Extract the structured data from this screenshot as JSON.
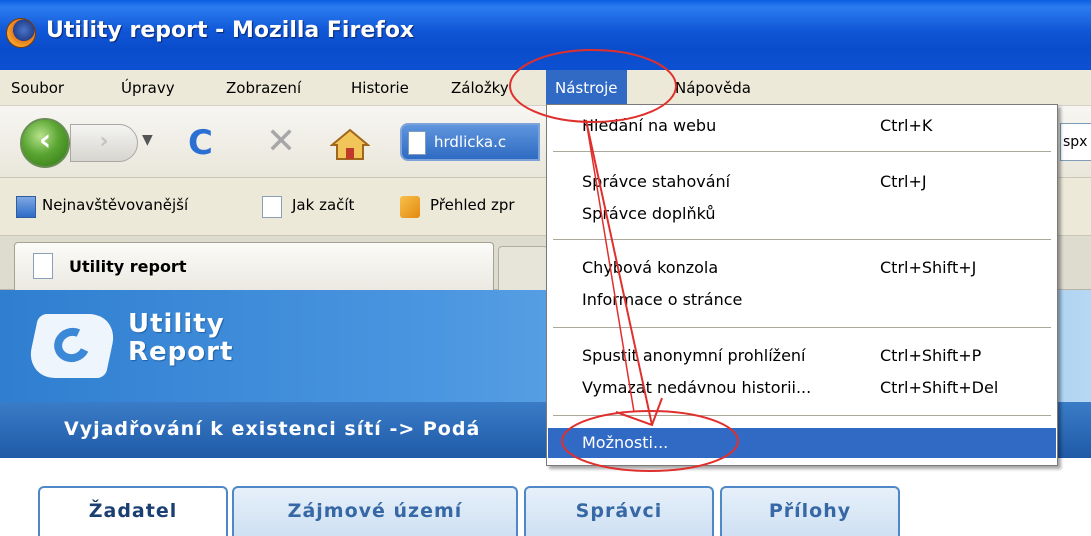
{
  "window": {
    "title": "Utility report - Mozilla Firefox"
  },
  "menubar": {
    "items": [
      "Soubor",
      "Úpravy",
      "Zobrazení",
      "Historie",
      "Záložky",
      "Nástroje",
      "Nápověda"
    ],
    "active": "Nástroje"
  },
  "navbar": {
    "url_text": "hrdlicka.c",
    "url_right_text": "spx",
    "icons": [
      "back-icon",
      "forward-icon",
      "dropdown-icon",
      "reload-icon",
      "stop-icon",
      "home-icon"
    ]
  },
  "bookmarks": {
    "items": [
      "Nejnavštěvovanější",
      "Jak začít",
      "Přehled zpr"
    ]
  },
  "tabs": {
    "active_label": "Utility report"
  },
  "page": {
    "logo_line1": "Utility",
    "logo_line2": "Report",
    "path": "Vyjadřování k existenci sítí -> Podá",
    "tabs": [
      "Žadatel",
      "Zájmové území",
      "Správci",
      "Přílohy"
    ],
    "active_tab": "Žadatel"
  },
  "dropdown": {
    "groups": [
      [
        {
          "label": "Hledání na webu",
          "shortcut": "Ctrl+K"
        }
      ],
      [
        {
          "label": "Správce stahování",
          "shortcut": "Ctrl+J"
        },
        {
          "label": "Správce doplňků",
          "shortcut": ""
        }
      ],
      [
        {
          "label": "Chybová konzola",
          "shortcut": "Ctrl+Shift+J"
        },
        {
          "label": "Informace o stránce",
          "shortcut": ""
        }
      ],
      [
        {
          "label": "Spustit anonymní prohlížení",
          "shortcut": "Ctrl+Shift+P"
        },
        {
          "label": "Vymazat nedávnou historii...",
          "shortcut": "Ctrl+Shift+Del"
        }
      ],
      [
        {
          "label": "Možnosti...",
          "shortcut": "",
          "highlighted": true
        }
      ]
    ]
  },
  "colors": {
    "titlebar": "#0a4ccb",
    "menu_highlight": "#316ac5",
    "annotation": "#e0302e"
  }
}
